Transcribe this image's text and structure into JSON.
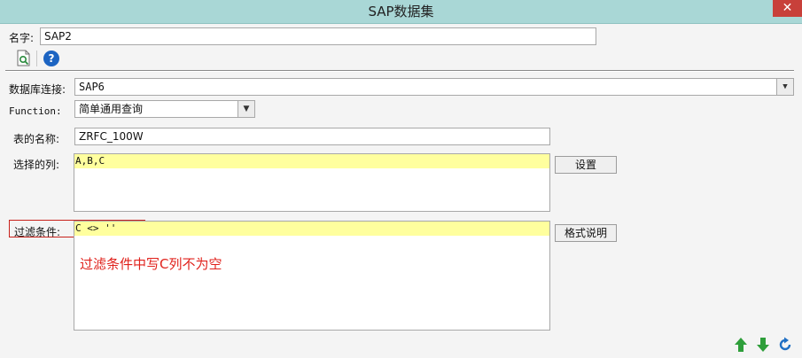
{
  "window": {
    "title": "SAP数据集",
    "close_glyph": "✕"
  },
  "name_row": {
    "label": "名字:",
    "value": "SAP2"
  },
  "toolbar": {
    "icons": [
      "preview-icon",
      "help-icon"
    ],
    "help_glyph": "?"
  },
  "db_connection": {
    "label": "数据库连接:",
    "value": "SAP6"
  },
  "function": {
    "label": "Function:",
    "value": "简单通用查询"
  },
  "table_name": {
    "label": "表的名称:",
    "value": "ZRFC_100W"
  },
  "columns": {
    "label": "选择的列:",
    "value": "A,B,C",
    "button": "设置"
  },
  "filter": {
    "label": "过滤条件:",
    "value": "C <> ''",
    "button": "格式说明",
    "annotation": "过滤条件中写C列不为空",
    "annotation_color": "#e0221c"
  },
  "footer": {
    "icons": [
      "move-up-icon",
      "move-down-icon",
      "refresh-icon"
    ]
  },
  "colors": {
    "titlebar": "#a9d7d6",
    "highlight": "#ffff9e",
    "green_arrow": "#2e9e3a",
    "refresh": "#1f6fc4"
  }
}
